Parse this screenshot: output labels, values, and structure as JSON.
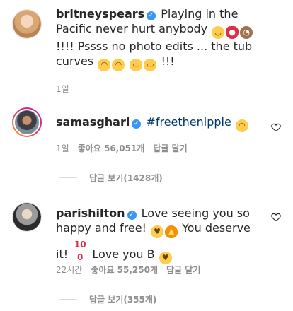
{
  "comments": [
    {
      "username": "britneyspears",
      "verified": true,
      "text_1": "Playing in the Pacific never hurt anybody",
      "text_2": "!!!! Pssss no photo edits ... the tub curves",
      "text_3": "!!!",
      "time": "1일",
      "emojis_1": [
        "smiling-face-emoji",
        "kiss-mark-emoji",
        "see-no-evil-monkey-emoji"
      ],
      "emojis_2": [
        "laughing-emoji",
        "laughing-emoji"
      ],
      "emojis_3": [
        "grimacing-face-emoji",
        "grimacing-face-emoji"
      ]
    },
    {
      "username": "samasghari",
      "verified": true,
      "hashtag": "#freethenipple",
      "time": "1일",
      "likes": "좋아요 56,051개",
      "reply_label": "답글 달기",
      "view_replies": "답글 보기(1428개)"
    },
    {
      "username": "parishilton",
      "verified": true,
      "text_1": "Love seeing you so happy and free!",
      "text_2": "You deserve it!",
      "text_3": "Love you B",
      "time": "22시간",
      "likes": "좋아요 55,250개",
      "reply_label": "답글 달기",
      "view_replies": "답글 보기(355개)"
    }
  ]
}
